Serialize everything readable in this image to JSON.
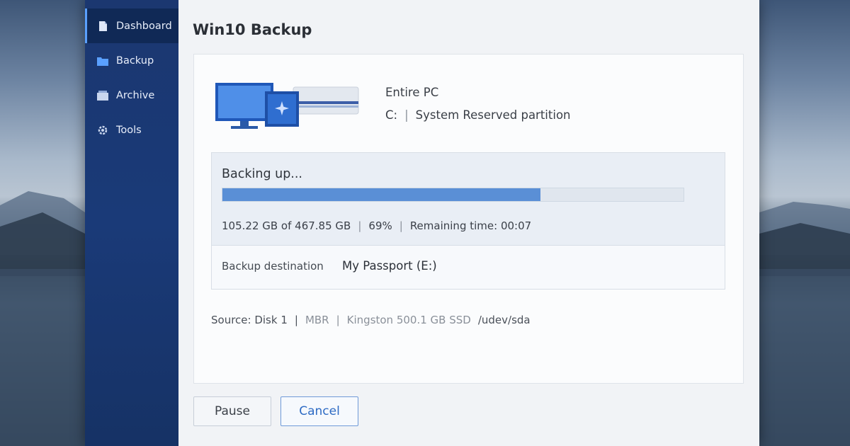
{
  "sidebar": {
    "items": [
      {
        "label": "Dashboard",
        "icon": "dashboard-icon",
        "active": true
      },
      {
        "label": "Backup",
        "icon": "folder-icon",
        "active": false
      },
      {
        "label": "Archive",
        "icon": "archive-icon",
        "active": false
      },
      {
        "label": "Tools",
        "icon": "gear-icon",
        "active": false
      }
    ]
  },
  "header": {
    "title": "Win10 Backup"
  },
  "source": {
    "title": "Entire PC",
    "drive": "C:",
    "separator": "|",
    "partition": "System Reserved partition"
  },
  "progress": {
    "status": "Backing up...",
    "percent_value": 69,
    "processed": "105.22 GB of 467.85 GB",
    "percent_text": "69%",
    "remaining": "Remaining time: 00:07",
    "sep": "|"
  },
  "destination": {
    "label": "Backup destination",
    "value": "My Passport (E:)"
  },
  "source_line": {
    "disk": "Source: Disk 1",
    "sep": "|",
    "scheme": "MBR",
    "model": "Kingston 500.1 GB SSD",
    "path": "/udev/sda"
  },
  "buttons": {
    "pause": "Pause",
    "cancel": "Cancel"
  },
  "colors": {
    "sidebar": "#1a3a78",
    "accent": "#5a8fd6",
    "cancel_text": "#2d6bc4"
  }
}
